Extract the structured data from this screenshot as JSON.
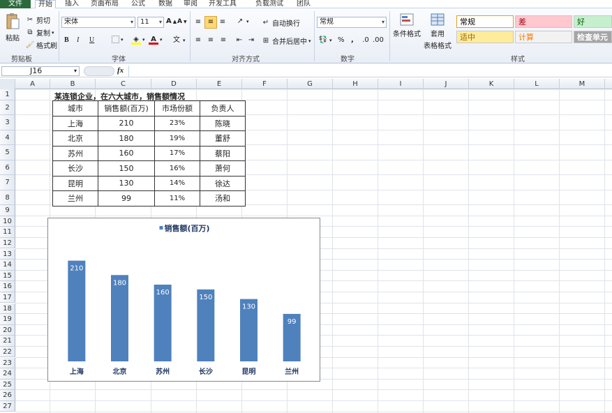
{
  "menu": {
    "tabs": [
      "文件",
      "开始",
      "插入",
      "页面布局",
      "公式",
      "数据",
      "审阅",
      "开发工具",
      "负载测试",
      "团队"
    ]
  },
  "ribbon": {
    "clipboard": {
      "paste": "粘贴",
      "cut": "剪切",
      "copy": "复制",
      "format_painter": "格式刷",
      "group": "剪贴板"
    },
    "font": {
      "name": "宋体",
      "size": "11",
      "bold": "B",
      "italic": "I",
      "underline": "U",
      "group": "字体"
    },
    "alignment": {
      "wrap": "自动换行",
      "merge": "合并后居中",
      "group": "对齐方式"
    },
    "number": {
      "format": "常规",
      "percent": "%",
      "comma": ",",
      "group": "数字"
    },
    "styles": {
      "conditional": "条件格式",
      "table_line1": "套用",
      "table_line2": "表格格式",
      "group": "样式",
      "cells": [
        {
          "label": "常规",
          "bg": "#ffffff",
          "fg": "#000000"
        },
        {
          "label": "差",
          "bg": "#ffc7ce",
          "fg": "#9c0006"
        },
        {
          "label": "好",
          "bg": "#c6efce",
          "fg": "#006100"
        },
        {
          "label": "适中",
          "bg": "#ffeb9c",
          "fg": "#9c6500"
        },
        {
          "label": "计算",
          "bg": "#f2f2f2",
          "fg": "#fa7d00"
        },
        {
          "label": "检查单元",
          "bg": "#a5a5a5",
          "fg": "#ffffff"
        }
      ]
    }
  },
  "formula_bar": {
    "name_box": "J16",
    "fx": "fx",
    "content": ""
  },
  "columns": [
    "A",
    "B",
    "C",
    "D",
    "E",
    "F",
    "G",
    "H",
    "I",
    "J",
    "K",
    "L",
    "M"
  ],
  "rows": [
    "1",
    "2",
    "3",
    "4",
    "5",
    "6",
    "7",
    "8",
    "9",
    "10",
    "11",
    "12",
    "13",
    "14",
    "15",
    "16",
    "17",
    "18",
    "19",
    "20",
    "21",
    "22",
    "23",
    "24",
    "25",
    "26",
    "27"
  ],
  "sheet": {
    "title": "某连锁企业，在六大城市，销售额情况",
    "headers": [
      "城市",
      "销售额(百万)",
      "市场份额",
      "负责人"
    ],
    "rows": [
      [
        "上海",
        "210",
        "23%",
        "陈晓"
      ],
      [
        "北京",
        "180",
        "19%",
        "董舒"
      ],
      [
        "苏州",
        "160",
        "17%",
        "蔡阳"
      ],
      [
        "长沙",
        "150",
        "16%",
        "萧何"
      ],
      [
        "昆明",
        "130",
        "14%",
        "徐达"
      ],
      [
        "兰州",
        "99",
        "11%",
        "汤和"
      ]
    ]
  },
  "chart_data": {
    "type": "bar",
    "title": "销售额(百万)",
    "legend": "top",
    "categories": [
      "上海",
      "北京",
      "苏州",
      "长沙",
      "昆明",
      "兰州"
    ],
    "series": [
      {
        "name": "销售额(百万)",
        "values": [
          210,
          180,
          160,
          150,
          130,
          99
        ]
      }
    ],
    "ylim": [
      0,
      240
    ],
    "grid": false,
    "color": "#4f81bd"
  }
}
